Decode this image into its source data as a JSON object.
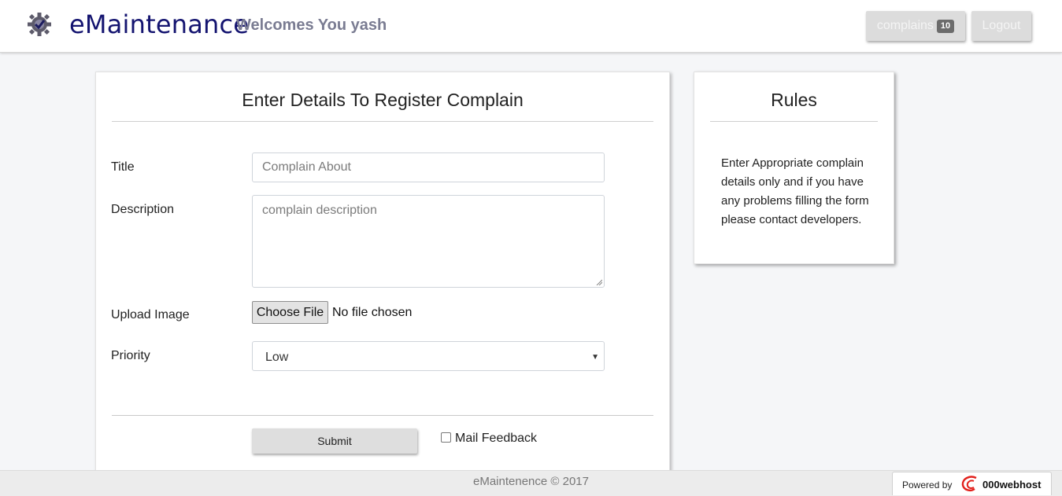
{
  "header": {
    "brand": "eMaintenance",
    "welcome": "Welcomes You yash",
    "complains_label": "complains",
    "complains_count": "10",
    "logout_label": "Logout",
    "logo_icon": "gear-check-icon"
  },
  "form": {
    "heading": "Enter Details To Register Complain",
    "title_label": "Title",
    "title_placeholder": "Complain About",
    "description_label": "Description",
    "description_placeholder": "complain description",
    "upload_label": "Upload Image",
    "choose_file_label": "Choose File",
    "no_file_text": "No file chosen",
    "priority_label": "Priority",
    "priority_value": "Low",
    "submit_label": "Submit",
    "mail_feedback_label": "Mail Feedback",
    "mail_feedback_checked": false
  },
  "rules": {
    "heading": "Rules",
    "text": "Enter Appropriate complain details only and if you have any problems filling the form please contact developers."
  },
  "footer": {
    "text": "eMaintenence © 2017",
    "powered_by": "Powered by",
    "host_name": "000webhost"
  },
  "colors": {
    "brand": "#141470",
    "welcome": "#7a7c92",
    "page_bg": "#f5f6f8",
    "button_bg": "#dcdcdc"
  }
}
